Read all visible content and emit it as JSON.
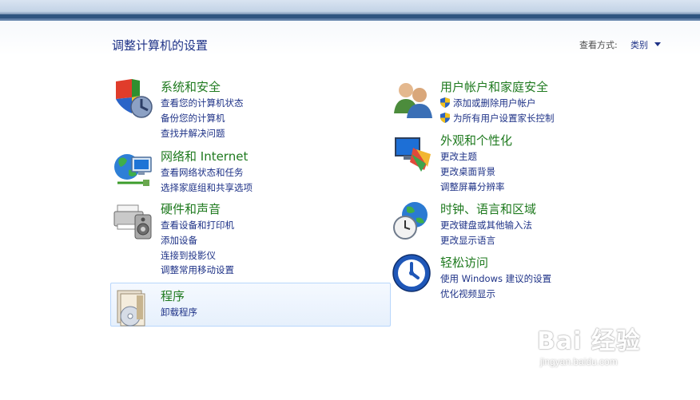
{
  "header": {
    "title": "调整计算机的设置",
    "view_by_label": "查看方式:",
    "view_by_value": "类别"
  },
  "categories_left": [
    {
      "title": "系统和安全",
      "icon": "system-security-icon",
      "links": [
        "查看您的计算机状态",
        "备份您的计算机",
        "查找并解决问题"
      ]
    },
    {
      "title": "网络和 Internet",
      "icon": "network-internet-icon",
      "links": [
        "查看网络状态和任务",
        "选择家庭组和共享选项"
      ]
    },
    {
      "title": "硬件和声音",
      "icon": "hardware-sound-icon",
      "links": [
        "查看设备和打印机",
        "添加设备",
        "连接到投影仪",
        "调整常用移动设置"
      ]
    },
    {
      "title": "程序",
      "icon": "programs-icon",
      "links": [
        "卸载程序"
      ]
    }
  ],
  "categories_right": [
    {
      "title": "用户帐户和家庭安全",
      "icon": "user-accounts-icon",
      "links": [
        "添加或删除用户帐户",
        "为所有用户设置家长控制"
      ]
    },
    {
      "title": "外观和个性化",
      "icon": "appearance-icon",
      "links": [
        "更改主题",
        "更改桌面背景",
        "调整屏幕分辨率"
      ]
    },
    {
      "title": "时钟、语言和区域",
      "icon": "clock-region-icon",
      "links": [
        "更改键盘或其他输入法",
        "更改显示语言"
      ]
    },
    {
      "title": "轻松访问",
      "icon": "ease-of-access-icon",
      "links": [
        "使用 Windows 建议的设置",
        "优化视频显示"
      ]
    }
  ],
  "watermark": {
    "brand": "Bai 经验",
    "url": "jingyan.baidu.com"
  },
  "colors": {
    "title": "#1e3287",
    "category": "#1f7a1f",
    "link": "#1e3287",
    "highlight_border": "#b8d6fb"
  }
}
